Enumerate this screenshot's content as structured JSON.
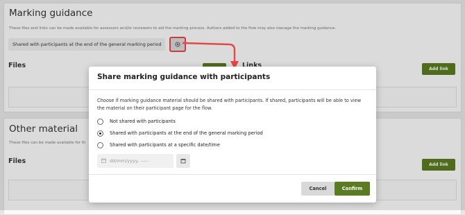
{
  "background": {
    "marking_guidance": {
      "title": "Marking guidance",
      "subtitle": "These files and links can be made available for assessors and/or reviewers to aid the marking process. Authors added to the flow may also manage the marking guidance.",
      "share_setting": "Shared with participants at the end of the general marking period",
      "files_label": "Files",
      "links_label": "Links",
      "add_link_label": "Add link"
    },
    "other_material": {
      "title": "Other material",
      "subtitle": "These files can be made available for th",
      "files_label": "Files",
      "add_link_label": "Add link"
    }
  },
  "modal": {
    "title": "Share marking guidance with participants",
    "description": "Choose if marking guidance material should be shared with participants. If shared, participants will be able to view the material on their participant page for the flow.",
    "options": [
      {
        "label": "Not shared with participants",
        "selected": false
      },
      {
        "label": "Shared with participants at the end of the general marking period",
        "selected": true
      },
      {
        "label": "Shared with participants at a specific date/time",
        "selected": false
      }
    ],
    "date_placeholder": "dd/mm/yyyy, --:--",
    "cancel_label": "Cancel",
    "confirm_label": "Confirm"
  },
  "icons": {
    "gear": "gear-icon",
    "calendar": "calendar-icon",
    "arrow": "red-arrow-annotation"
  },
  "colors": {
    "accent": "#5b7b22",
    "annotation": "#e84545"
  }
}
